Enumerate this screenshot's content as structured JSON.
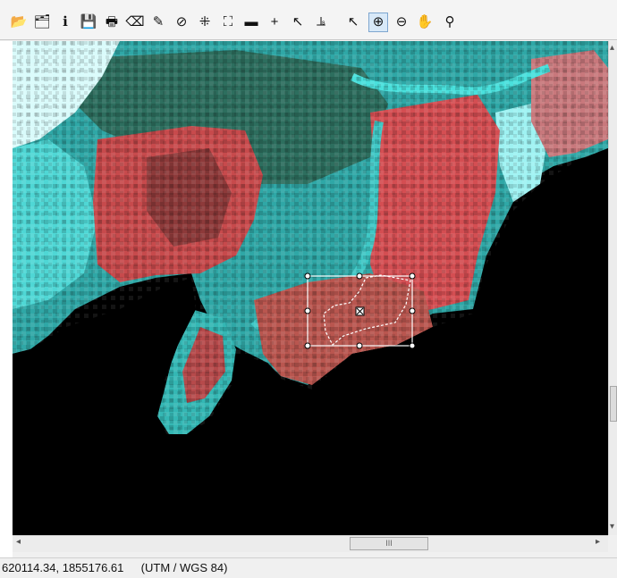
{
  "toolbar": {
    "tools": [
      {
        "icon": "open-folder-icon",
        "glyph": "📂"
      },
      {
        "icon": "open-layer-icon",
        "glyph": "🗂"
      },
      {
        "icon": "info-icon",
        "glyph": "ℹ"
      },
      {
        "icon": "save-icon",
        "glyph": "💾"
      },
      {
        "icon": "print-icon",
        "glyph": "🖶"
      },
      {
        "icon": "eraser-icon",
        "glyph": "⌫"
      },
      {
        "icon": "pencil-icon",
        "glyph": "✎"
      },
      {
        "icon": "clear-selection-icon",
        "glyph": "⊘"
      },
      {
        "icon": "zoom-extent-icon",
        "glyph": "⁜"
      },
      {
        "icon": "full-extent-icon",
        "glyph": "⛶"
      },
      {
        "icon": "measure-icon",
        "glyph": "▬"
      },
      {
        "icon": "crosshair-icon",
        "glyph": "+"
      },
      {
        "icon": "draw-line-icon",
        "glyph": "↖"
      },
      {
        "icon": "profile-chart-icon",
        "glyph": "⫡"
      },
      {
        "icon": "pointer-icon",
        "glyph": "↖"
      },
      {
        "icon": "zoom-in-icon",
        "glyph": "⊕",
        "active": true
      },
      {
        "icon": "zoom-out-icon",
        "glyph": "⊖"
      },
      {
        "icon": "pan-hand-icon",
        "glyph": "✋"
      },
      {
        "icon": "identify-pin-icon",
        "glyph": "⚲"
      }
    ]
  },
  "scrollbar": {
    "thumb_label": "III",
    "left_arrow": "◂",
    "right_arrow": "▸",
    "up_arrow": "▴",
    "down_arrow": "▾"
  },
  "status": {
    "coordinates": "620114.34, 1855176.61",
    "projection": "(UTM / WGS 84)"
  },
  "colors": {
    "nodata": "#000000",
    "water": "#35c6c6",
    "vegetation": "#c94848",
    "haze": "#d9fbfb"
  }
}
